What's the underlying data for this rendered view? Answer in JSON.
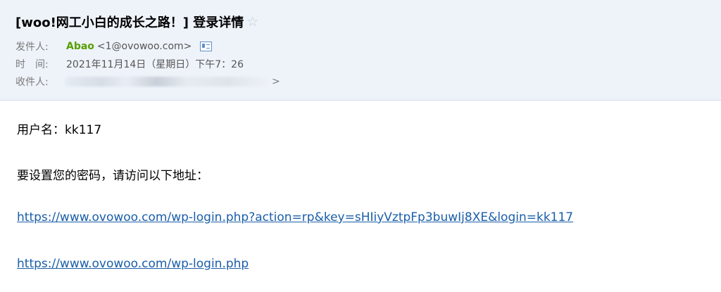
{
  "email": {
    "subject": "[woo!网工小白的成长之路！] 登录详情",
    "star_icon": "☆",
    "from_label": "发件人:",
    "sender_name": "Abao",
    "sender_email": "<1@ovowoo.com>",
    "time_label": "时　间:",
    "date": "2021年11月14日（星期日）下午7：26",
    "to_label": "收件人:",
    "recipient_end": ">"
  },
  "body": {
    "username_line": "用户名：kk117",
    "instruction_line": "要设置您的密码，请访问以下地址：",
    "reset_link": "https://www.ovowoo.com/wp-login.php?action=rp&key=sHIiyVztpFp3buwIj8XE&login=kk117",
    "login_link": "https://www.ovowoo.com/wp-login.php"
  },
  "colors": {
    "header_bg": "#eef3fa",
    "sender_name": "#56a000",
    "link": "#1a5ea8",
    "label": "#7a7a7a"
  }
}
